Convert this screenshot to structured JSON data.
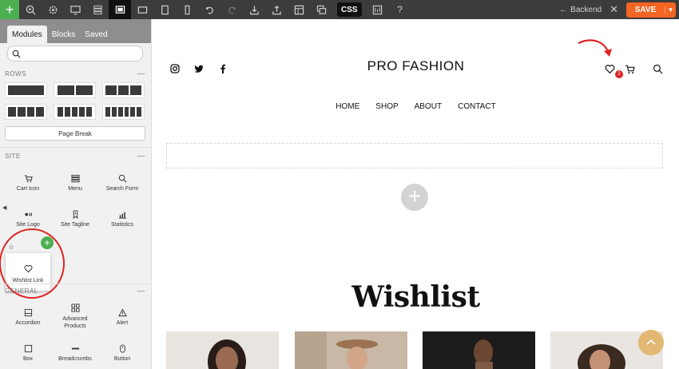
{
  "toolbar": {
    "add_icon": "plus-icon",
    "css_label": "CSS",
    "backend_label": "Backend",
    "save_label": "SAVE",
    "colors": {
      "bar": "#3c3c3c",
      "add": "#4caf50",
      "save": "#f26522"
    }
  },
  "panel": {
    "tabs": [
      {
        "label": "Modules"
      },
      {
        "label": "Blocks"
      },
      {
        "label": "Saved"
      }
    ],
    "search_placeholder": "",
    "rows": {
      "title": "ROWS",
      "page_break_label": "Page Break"
    },
    "site": {
      "title": "SITE",
      "modules": [
        {
          "label": "Cart Icon",
          "icon": "cart-icon"
        },
        {
          "label": "Menu",
          "icon": "menu-icon"
        },
        {
          "label": "Search Form",
          "icon": "search-icon"
        },
        {
          "label": "Site Logo",
          "icon": "logo-icon"
        },
        {
          "label": "Site Tagline",
          "icon": "tagline-icon"
        },
        {
          "label": "Statistics",
          "icon": "statistics-icon"
        },
        {
          "label": "Wishlist Link",
          "icon": "heart-icon"
        }
      ]
    },
    "general": {
      "title": "GENERAL",
      "modules": [
        {
          "label": "Accordion",
          "icon": "accordion-icon"
        },
        {
          "label": "Advanced Products",
          "icon": "grid-icon"
        },
        {
          "label": "Alert",
          "icon": "alert-icon"
        },
        {
          "label": "Box",
          "icon": "box-icon"
        },
        {
          "label": "Breadcrumbs",
          "icon": "breadcrumbs-icon"
        },
        {
          "label": "Button",
          "icon": "button-icon"
        }
      ]
    },
    "highlight_color": "#e02424"
  },
  "canvas": {
    "brand": "PRO FASHION",
    "nav": [
      "HOME",
      "SHOP",
      "ABOUT",
      "CONTACT"
    ],
    "wishlist_count": "2",
    "heading": "Wishlist",
    "accent": "#e2b872"
  }
}
